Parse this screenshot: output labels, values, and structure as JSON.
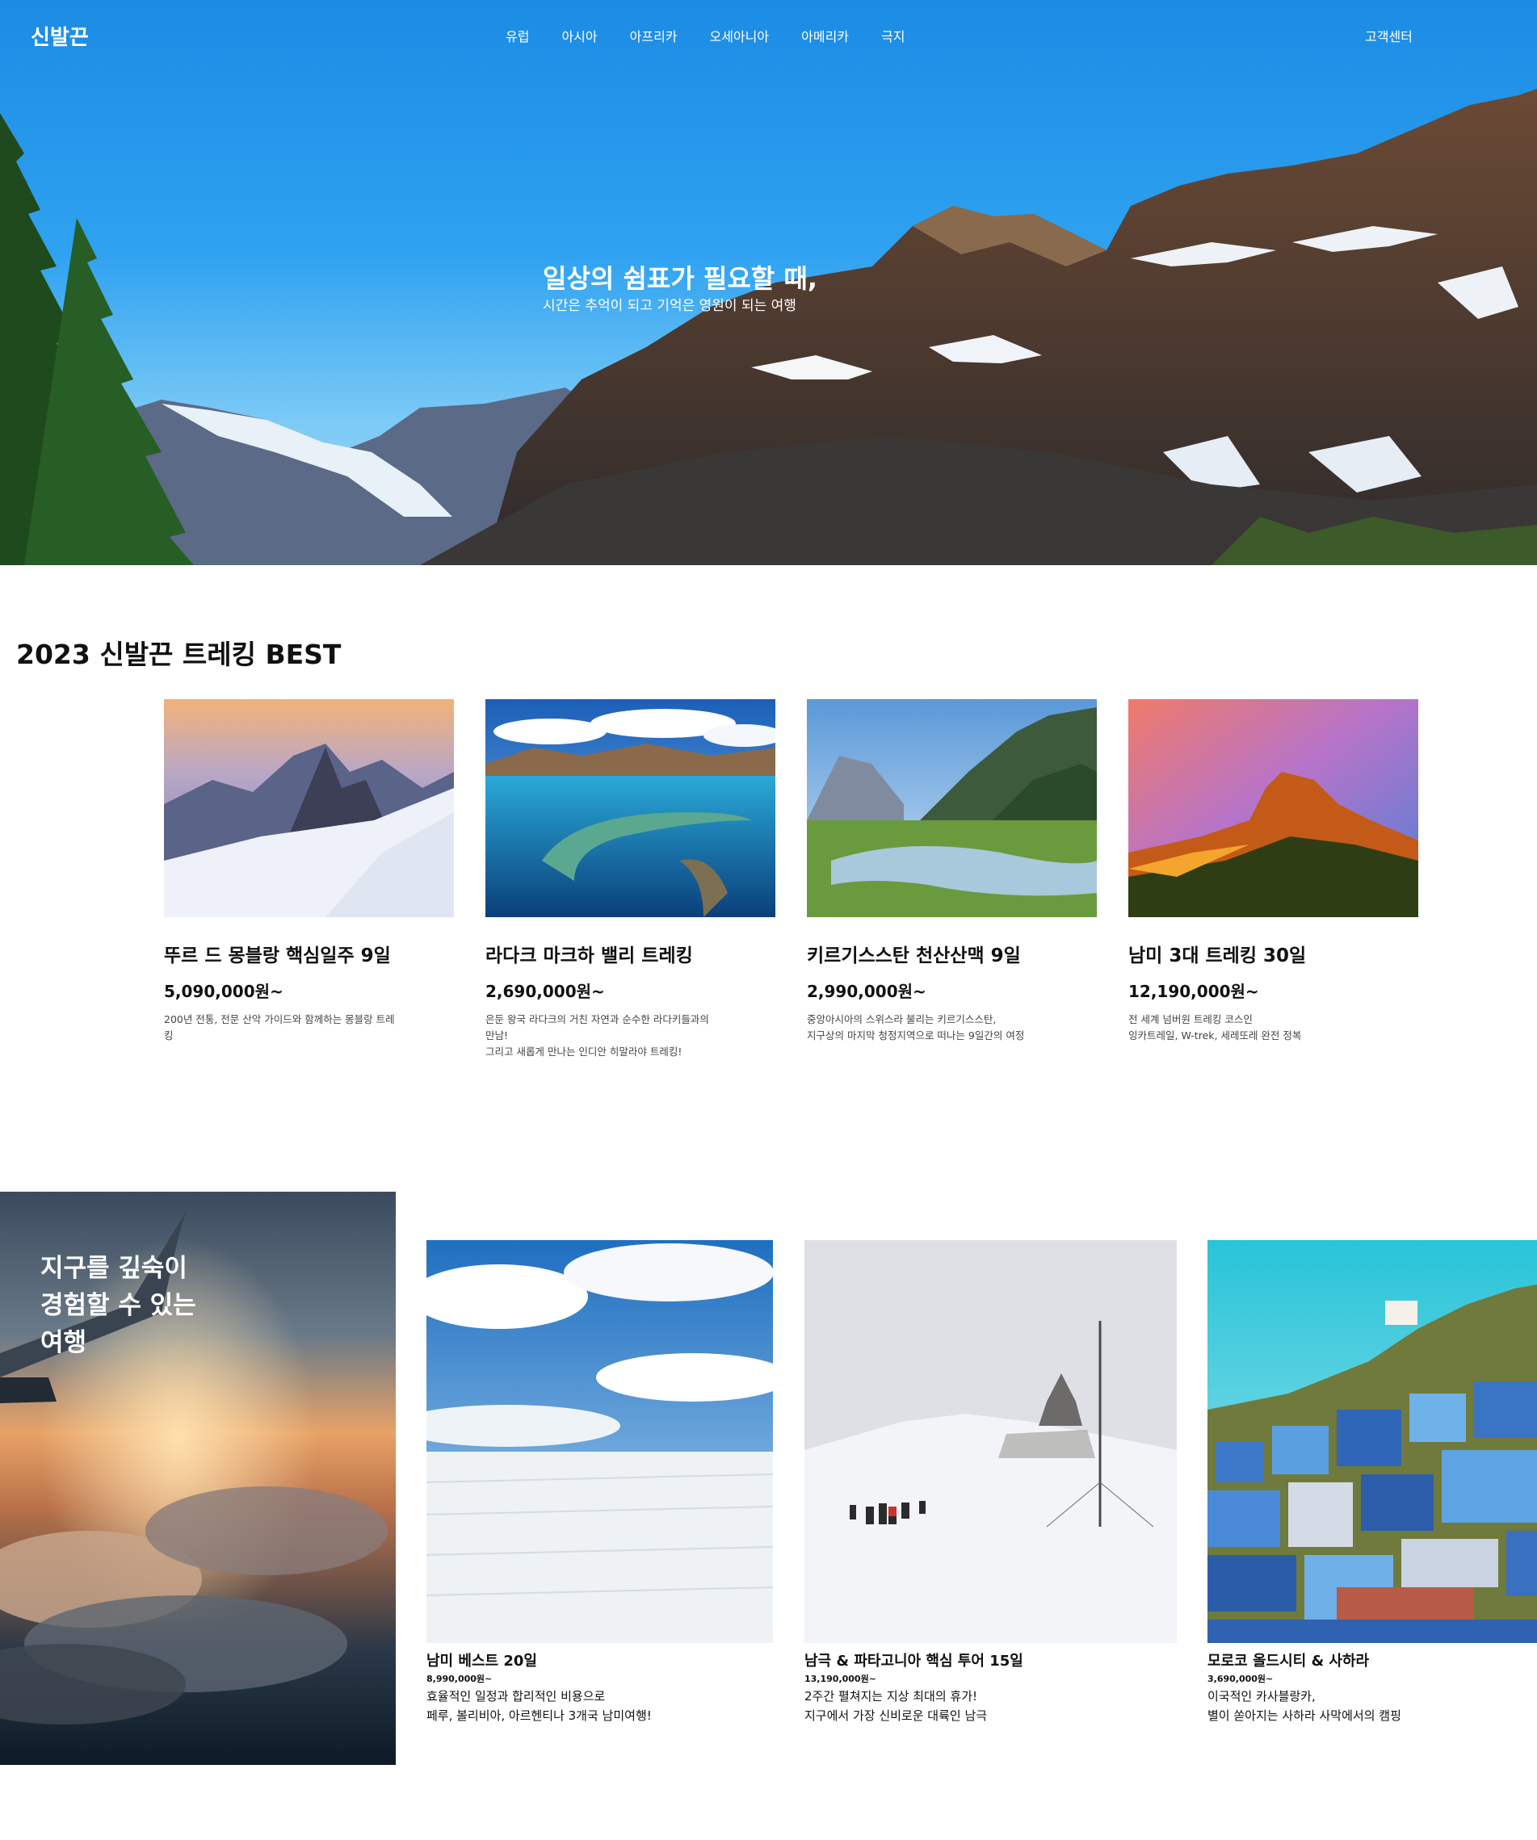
{
  "header": {
    "logo": "신발끈",
    "menu": [
      "유럽",
      "아시아",
      "아프리카",
      "오세아니아",
      "아메리카",
      "극지"
    ],
    "support": "고객센터"
  },
  "hero": {
    "title": "일상의 쉼표가 필요할 때,",
    "subtitle": "시간은 추억이 되고 기억은 영원이 되는 여행"
  },
  "best": {
    "title": "2023 신발끈 트레킹 BEST",
    "cards": [
      {
        "name": "뚜르 드 몽블랑 핵심일주 9일",
        "price": "5,090,000원~",
        "desc": [
          "200년 전통, 전문 산악 가이드와 함께하는 몽블랑 트레",
          "킹"
        ]
      },
      {
        "name": "라다크 마크하 밸리 트레킹",
        "price": "2,690,000원~",
        "desc": [
          "은둔 왕국 라다크의 거친 자연과 순수한 라다키들과의",
          "만남!",
          "그리고 새롭게 만나는 인디안 히말라야 트레킹!"
        ]
      },
      {
        "name": "키르기스스탄 천산산맥 9일",
        "price": "2,990,000원~",
        "desc": [
          "중앙아시아의 스위스라 불리는 키르기스스탄,",
          "지구상의 마지막 청정지역으로 떠나는 9일간의 여정"
        ]
      },
      {
        "name": "남미 3대 트레킹 30일",
        "price": "12,190,000원~",
        "desc": [
          "전 세계 넘버원 트레킹 코스인",
          "잉카트레일, W-trek, 세레또레 완전 정복"
        ]
      }
    ]
  },
  "feature": {
    "lines": [
      "지구를 깊숙이",
      "경험할 수 있는",
      "여행"
    ]
  },
  "tours": [
    {
      "name": "남미 베스트 20일",
      "price": "8,990,000원~",
      "desc": [
        "효율적인 일정과 합리적인 비용으로",
        "페루, 볼리비아, 아르헨티나 3개국 남미여행!"
      ]
    },
    {
      "name": "남극 & 파타고니아 핵심 투어 15일",
      "price": "13,190,000원~",
      "desc": [
        "2주간 펼쳐지는 지상 최대의 휴가!",
        "지구에서 가장 신비로운 대륙인 남극"
      ]
    },
    {
      "name": "모로코 올드시티 & 사하라",
      "price": "3,690,000원~",
      "desc": [
        "이국적인 카사블랑카,",
        "별이 쏟아지는 사하라 사막에서의 캠핑"
      ]
    }
  ]
}
